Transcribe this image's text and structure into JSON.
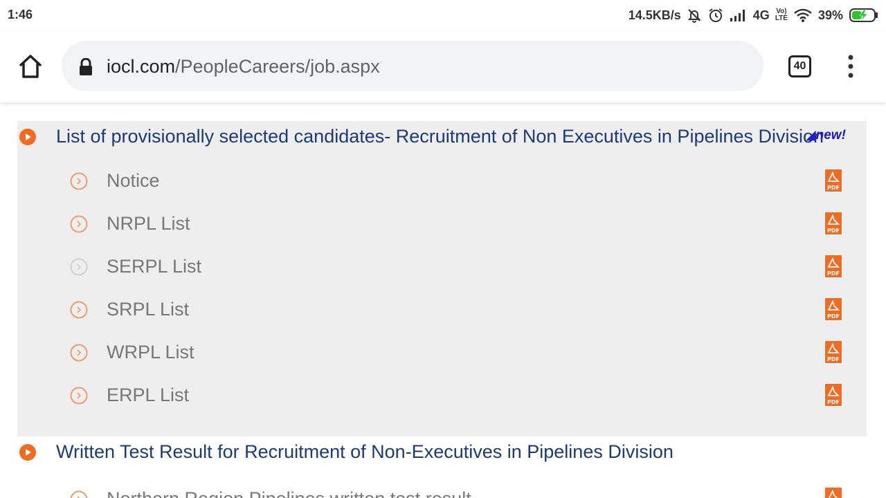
{
  "statusbar": {
    "time": "1:46",
    "speed": "14.5KB/s",
    "network": "4G",
    "volte_top": "Vo)",
    "volte_bottom": "LTE",
    "battery": "39%"
  },
  "browser": {
    "url_domain": "iocl.com",
    "url_path": "/PeopleCareers/job.aspx",
    "tab_count": "40"
  },
  "sections": [
    {
      "title": "List of provisionally selected candidates- Recruitment of Non Executives in Pipelines Division",
      "badge": "new!",
      "items": [
        {
          "label": "Notice"
        },
        {
          "label": "NRPL List"
        },
        {
          "label": "SERPL List"
        },
        {
          "label": "SRPL List"
        },
        {
          "label": "WRPL List"
        },
        {
          "label": "ERPL List"
        }
      ]
    },
    {
      "title": "Written Test Result for Recruitment of Non-Executives in Pipelines Division",
      "items": [
        {
          "label": "Northern Region Pipelines written test result"
        }
      ]
    }
  ],
  "colors": {
    "accent_orange": "#f26b21",
    "link_blue": "#1b3a7a",
    "section_bg": "#eeeeee"
  },
  "icons": [
    "home-icon",
    "lock-icon",
    "more-vert-icon",
    "play-circle-icon",
    "chevron-circle-icon",
    "pdf-icon"
  ]
}
